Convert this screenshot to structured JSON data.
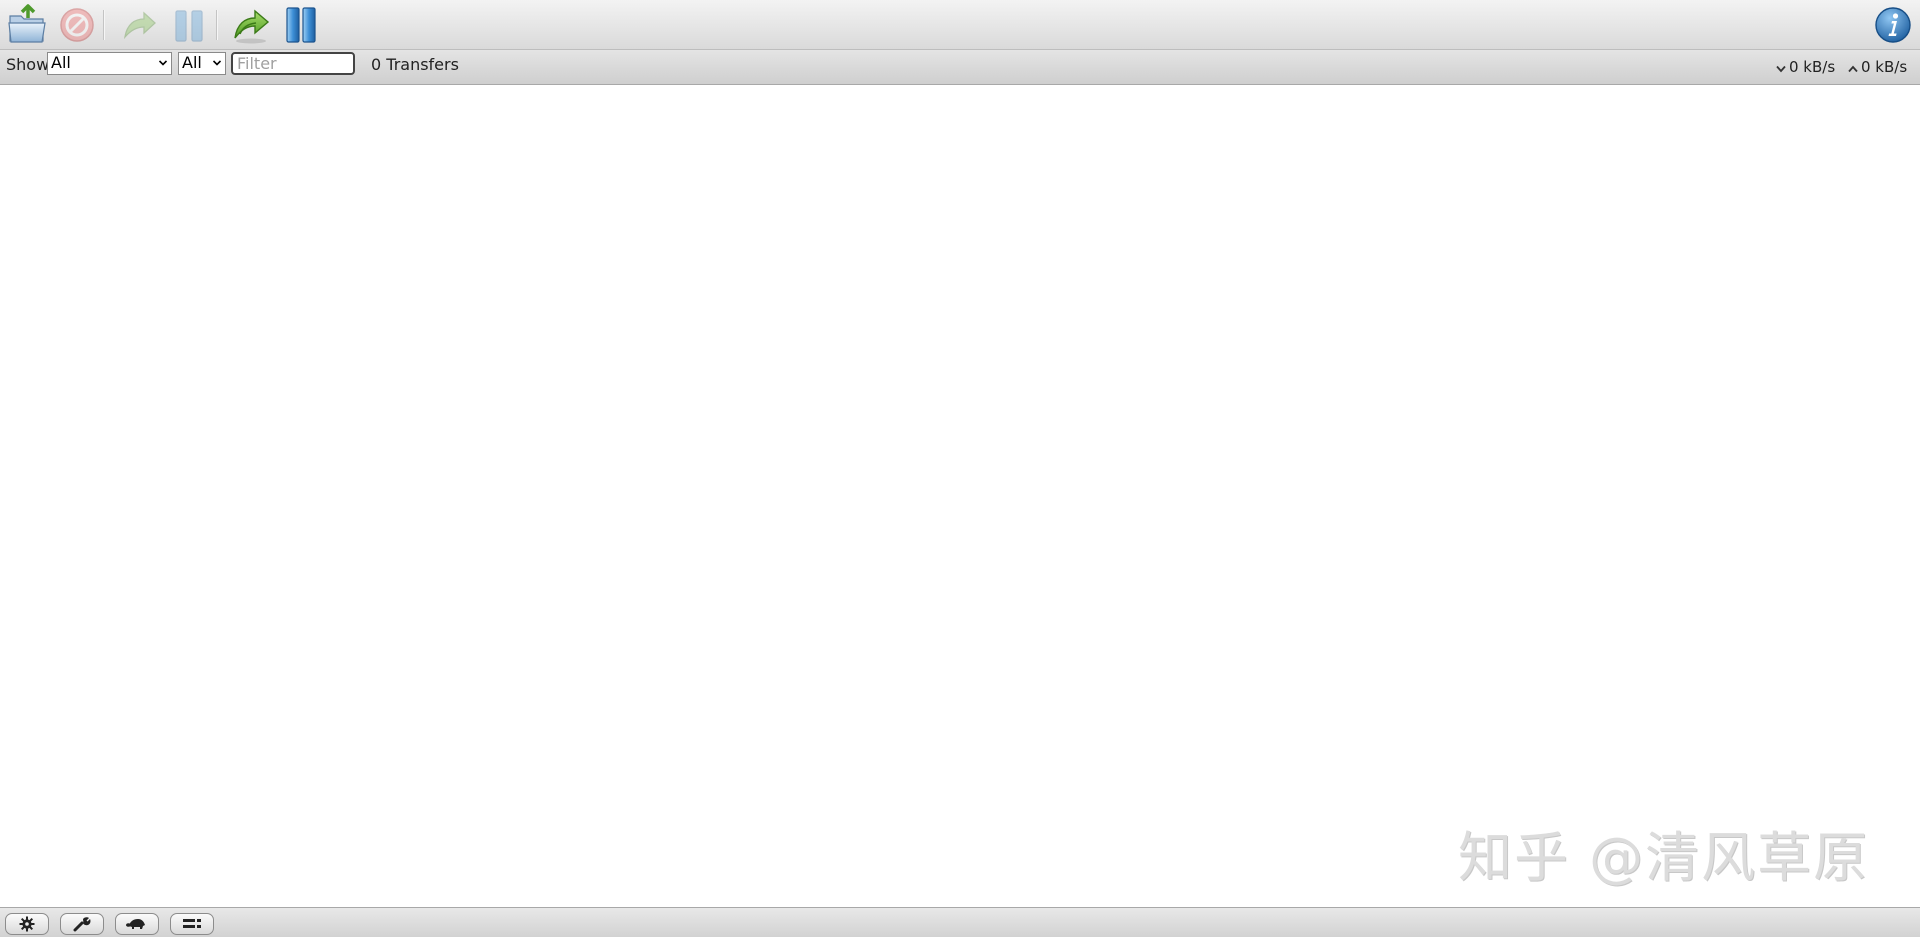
{
  "toolbar": {
    "buttons": [
      {
        "name": "open-torrent",
        "icon": "open-folder-icon",
        "enabled": true
      },
      {
        "name": "remove-torrent",
        "icon": "remove-circle-icon",
        "enabled": false
      },
      {
        "name": "resume-selected",
        "icon": "resume-arrow-icon",
        "enabled": false
      },
      {
        "name": "pause-selected",
        "icon": "pause-icon",
        "enabled": false
      },
      {
        "name": "resume-all",
        "icon": "resume-all-arrow-icon",
        "enabled": true
      },
      {
        "name": "pause-all",
        "icon": "pause-all-icon",
        "enabled": true
      },
      {
        "name": "inspector",
        "icon": "info-icon",
        "enabled": true
      }
    ]
  },
  "filterbar": {
    "show_label": "Show",
    "state_filter": {
      "selected": "All"
    },
    "tracker_filter": {
      "selected": "All"
    },
    "search": {
      "placeholder": "Filter",
      "value": ""
    },
    "transfer_count": "0 Transfers",
    "download_rate": "0 kB/s",
    "upload_rate": "0 kB/s"
  },
  "watermark": "知乎 @清风草原",
  "bottombar": {
    "buttons": [
      {
        "name": "settings",
        "icon": "gear-icon"
      },
      {
        "name": "preferences",
        "icon": "wrench-icon"
      },
      {
        "name": "turtle-mode",
        "icon": "turtle-icon"
      },
      {
        "name": "compact-view",
        "icon": "list-icon"
      }
    ]
  },
  "colors": {
    "toolbar_top": "#f3f3f3",
    "toolbar_bottom": "#dadada",
    "filterbar_top": "#e4e4e4",
    "filterbar_bottom": "#cfcfcf",
    "accent_green": "#6db33f",
    "accent_blue": "#2f7fc8",
    "remove_red": "#e04848"
  }
}
